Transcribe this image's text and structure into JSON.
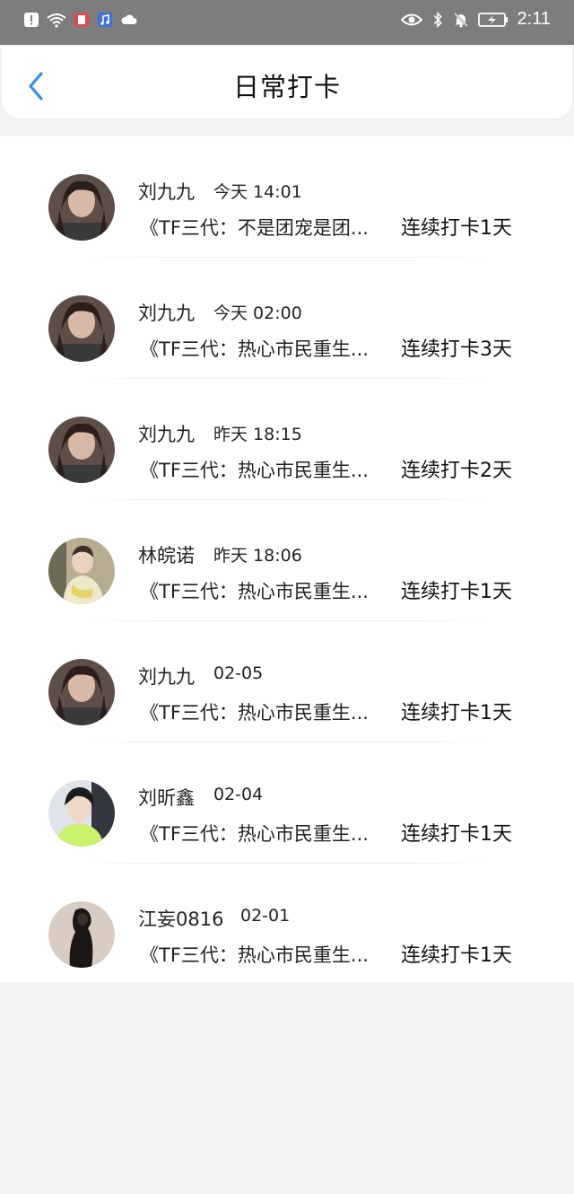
{
  "status_bar": {
    "time": "2:11",
    "icons_left": [
      "alert-icon",
      "wifi-icon",
      "app-notification-icon",
      "music-app-icon",
      "cloud-icon"
    ],
    "icons_right": [
      "eye-icon",
      "bluetooth-icon",
      "mute-bell-icon",
      "battery-icon"
    ]
  },
  "header": {
    "title": "日常打卡",
    "back_color": "#2e8ff0"
  },
  "items": [
    {
      "name": "刘九九",
      "time": "今天 14:01",
      "title": "《TF三代：不是团宠是团...",
      "streak": "连续打卡1天",
      "avatar": "avatar-photo-1"
    },
    {
      "name": "刘九九",
      "time": "今天 02:00",
      "title": "《TF三代：热心市民重生...",
      "streak": "连续打卡3天",
      "avatar": "avatar-photo-1"
    },
    {
      "name": "刘九九",
      "time": "昨天 18:15",
      "title": "《TF三代：热心市民重生...",
      "streak": "连续打卡2天",
      "avatar": "avatar-photo-1"
    },
    {
      "name": "林皖诺",
      "time": "昨天 18:06",
      "title": "《TF三代：热心市民重生...",
      "streak": "连续打卡1天",
      "avatar": "avatar-photo-2"
    },
    {
      "name": "刘九九",
      "time": "02-05",
      "title": "《TF三代：热心市民重生...",
      "streak": "连续打卡1天",
      "avatar": "avatar-photo-1"
    },
    {
      "name": "刘昕鑫",
      "time": "02-04",
      "title": "《TF三代：热心市民重生...",
      "streak": "连续打卡1天",
      "avatar": "avatar-photo-3"
    },
    {
      "name": "江妄0816",
      "time": "02-01",
      "title": "《TF三代：热心市民重生...",
      "streak": "连续打卡1天",
      "avatar": "avatar-photo-4"
    }
  ]
}
